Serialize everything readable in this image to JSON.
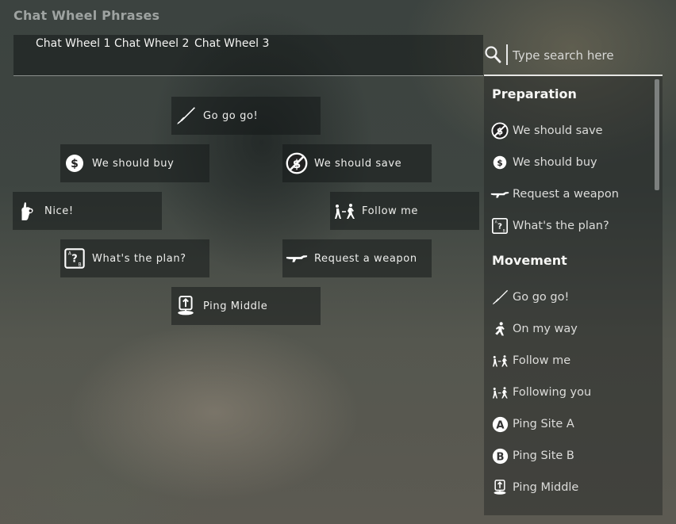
{
  "title": "Chat Wheel Phrases",
  "tabs": [
    "Chat Wheel 1",
    "Chat Wheel 2",
    "Chat Wheel 3"
  ],
  "wheel": {
    "go": "Go go go!",
    "buy": "We should buy",
    "save": "We should save",
    "nice": "Nice!",
    "follow": "Follow me",
    "plan": "What's the plan?",
    "weapon": "Request a weapon",
    "ping_middle": "Ping Middle"
  },
  "search": {
    "placeholder": "Type search here"
  },
  "panel": {
    "sections": [
      {
        "title": "Preparation",
        "items": [
          {
            "label": "We should save",
            "icon": "no-money-icon"
          },
          {
            "label": "We should buy",
            "icon": "dollar-icon"
          },
          {
            "label": "Request a weapon",
            "icon": "rifle-icon"
          },
          {
            "label": "What's the plan?",
            "icon": "question-icon"
          }
        ]
      },
      {
        "title": "Movement",
        "items": [
          {
            "label": "Go go go!",
            "icon": "knife-icon"
          },
          {
            "label": "On my way",
            "icon": "running-soldier-icon"
          },
          {
            "label": "Follow me",
            "icon": "follow-soldiers-icon"
          },
          {
            "label": "Following you",
            "icon": "following-soldiers-icon"
          },
          {
            "label": "Ping Site A",
            "icon": "site-a-icon"
          },
          {
            "label": "Ping Site B",
            "icon": "site-b-icon"
          },
          {
            "label": "Ping Middle",
            "icon": "map-pin-icon"
          }
        ]
      }
    ]
  }
}
